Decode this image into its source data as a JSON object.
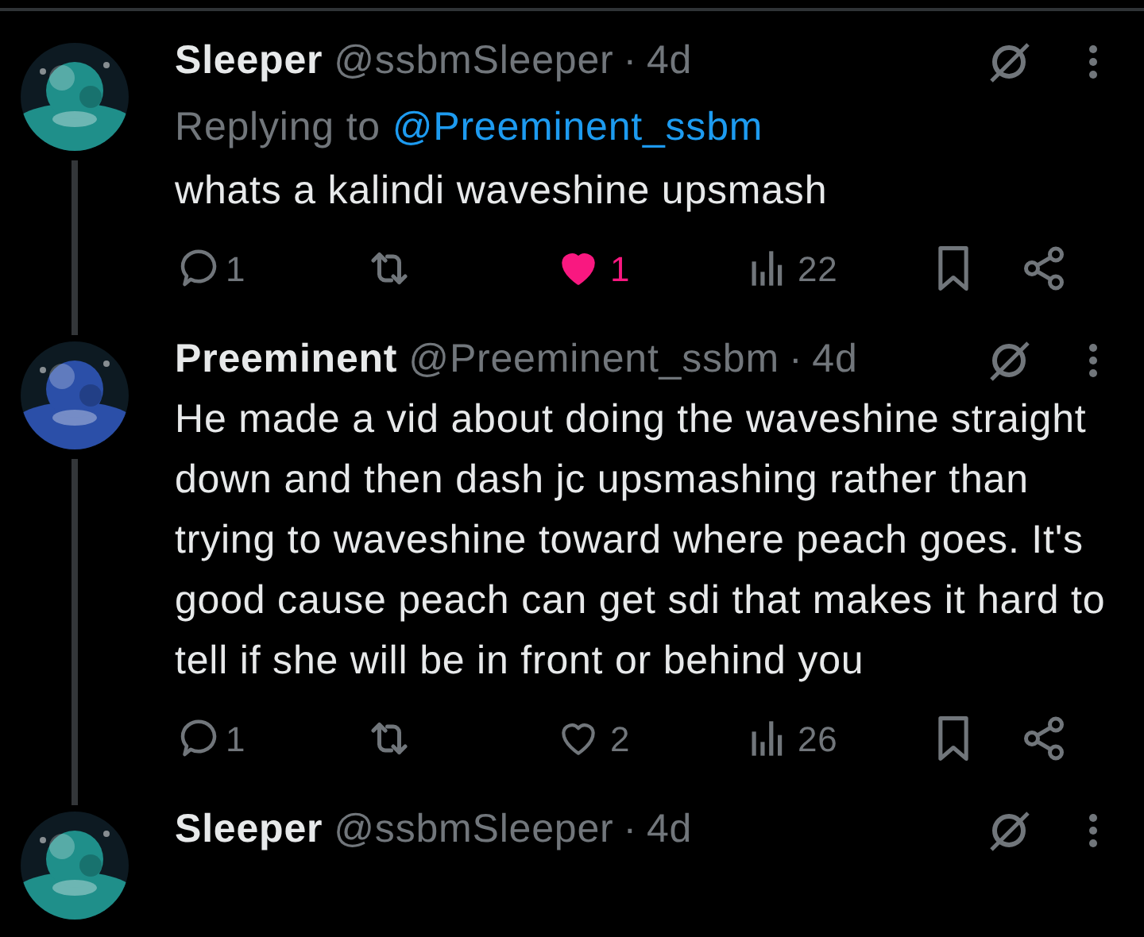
{
  "tweets": [
    {
      "name": "Sleeper",
      "handle": "@ssbmSleeper",
      "separator": "·",
      "time": "4d",
      "thread_line": true,
      "replying_prefix": "Replying to",
      "replying_to": "@Preeminent_ssbm",
      "text": "whats a kalindi waveshine upsmash",
      "replies": "1",
      "likes": "1",
      "liked": true,
      "views": "22"
    },
    {
      "name": "Preeminent",
      "handle": "@Preeminent_ssbm",
      "separator": "·",
      "time": "4d",
      "thread_line": true,
      "text": "He made a vid about doing the waveshine straight down and then dash jc upsmashing rather than trying to waveshine toward where peach goes. It's good cause peach can get sdi that makes it hard to tell if she will be in front or behind you",
      "replies": "1",
      "likes": "2",
      "liked": false,
      "views": "26"
    },
    {
      "name": "Sleeper",
      "handle": "@ssbmSleeper",
      "separator": "·",
      "time": "4d",
      "thread_line": false
    }
  ]
}
